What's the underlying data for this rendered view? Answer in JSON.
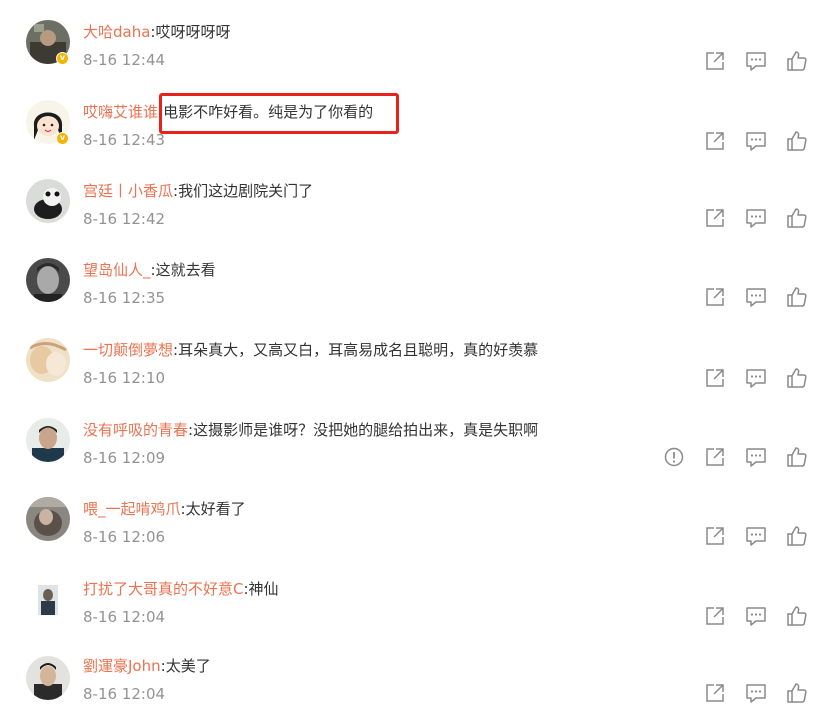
{
  "comments": [
    {
      "user": "大哈daha",
      "text": "哎呀呀呀呀",
      "time": "8-16 12:44",
      "verified": true
    },
    {
      "user": "哎嗨艾谁谁",
      "text": "电影不咋好看。纯是为了你看的",
      "time": "8-16 12:43",
      "verified": true
    },
    {
      "user": "宫廷丨小香瓜",
      "text": "我们这边剧院关门了",
      "time": "8-16 12:42",
      "verified": false
    },
    {
      "user": "望岛仙人_",
      "text": "这就去看",
      "time": "8-16 12:35",
      "verified": false
    },
    {
      "user": "一切颠倒夢想",
      "text": "耳朵真大，又高又白，耳高易成名且聪明，真的好羡慕",
      "time": "8-16 12:10",
      "verified": false
    },
    {
      "user": "没有呼吸的青春",
      "text": "这摄影师是谁呀？没把她的腿给拍出来，真是失职啊",
      "time": "8-16 12:09",
      "verified": false,
      "report": true
    },
    {
      "user": "喂_一起啃鸡爪",
      "text": "太好看了",
      "time": "8-16 12:06",
      "verified": false
    },
    {
      "user": "打扰了大哥真的不好意C",
      "text": "神仙",
      "time": "8-16 12:04",
      "verified": false
    },
    {
      "user": "劉運豪John",
      "text": "太美了",
      "time": "8-16 12:04",
      "verified": false
    }
  ],
  "separator": ":",
  "badge_glyph": "v",
  "colors": {
    "username": "#eb7350",
    "text": "#333333",
    "time": "#939393",
    "icon": "#8a8a8a",
    "highlight": "#e8211b",
    "badge": "#f4b400"
  }
}
